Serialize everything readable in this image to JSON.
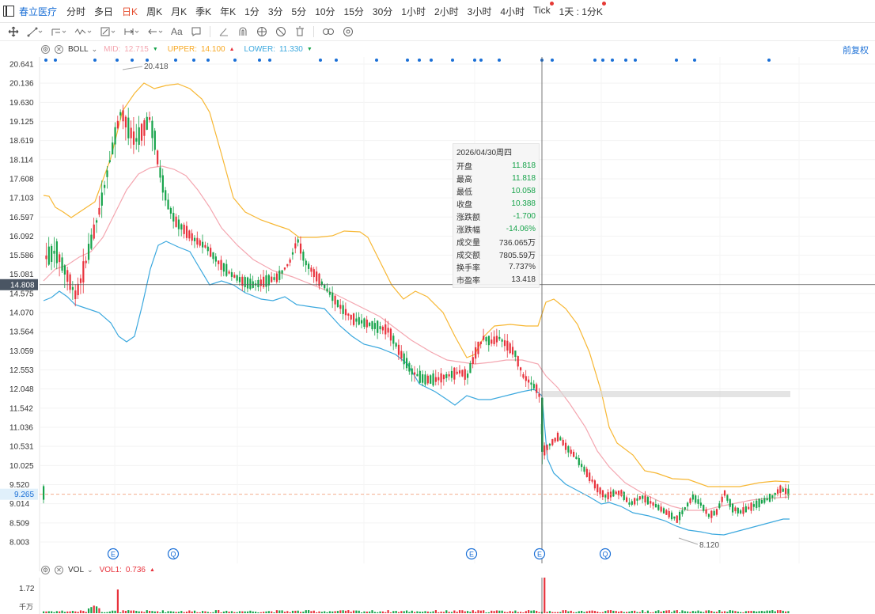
{
  "topbar": {
    "stock_name": "春立医疗",
    "periods": [
      "分时",
      "多日",
      "日K",
      "周K",
      "月K",
      "季K",
      "年K",
      "1分",
      "3分",
      "5分",
      "10分",
      "15分",
      "30分",
      "1小时",
      "2小时",
      "3小时",
      "4小时",
      "Tick",
      "1天 : 1分K"
    ],
    "active_period": "日K"
  },
  "toolbar": {
    "icons": [
      "crosshair-icon",
      "line-tool-icon",
      "channel-tool-icon",
      "wave-tool-icon",
      "measure-tool-icon",
      "range-tool-icon",
      "arrow-back-icon",
      "text-tool-icon",
      "comment-icon",
      "angle-icon",
      "magnet-icon",
      "eye-icon",
      "hide-icon",
      "trash-icon",
      "link-icon",
      "settings-icon"
    ],
    "text_tool_label": "Aa"
  },
  "boll": {
    "name": "BOLL",
    "mid_label": "MID:",
    "mid_value": "12.715",
    "upper_label": "UPPER:",
    "upper_value": "14.100",
    "lower_label": "LOWER:",
    "lower_value": "11.330",
    "colors": {
      "mid": "#f4a6b0",
      "upper": "#f7b733",
      "lower": "#3ba8de"
    }
  },
  "restore_label": "前复权",
  "tooltip": {
    "date": "2026/04/30周四",
    "rows": [
      {
        "k": "开盘",
        "v": "11.818",
        "color": "green"
      },
      {
        "k": "最高",
        "v": "11.818",
        "color": "green"
      },
      {
        "k": "最低",
        "v": "10.058",
        "color": "green"
      },
      {
        "k": "收盘",
        "v": "10.388",
        "color": "green"
      },
      {
        "k": "涨跌额",
        "v": "-1.700",
        "color": "green"
      },
      {
        "k": "涨跌幅",
        "v": "-14.06%",
        "color": "green"
      },
      {
        "k": "成交量",
        "v": "736.065万",
        "color": "gray"
      },
      {
        "k": "成交额",
        "v": "7805.59万",
        "color": "gray"
      },
      {
        "k": "换手率",
        "v": "7.737%",
        "color": "gray"
      },
      {
        "k": "市盈率",
        "v": "13.418",
        "color": "gray"
      }
    ]
  },
  "volume": {
    "name": "VOL",
    "vol1_label": "VOL1:",
    "vol1_value": "0.736",
    "axis_max": "1.72",
    "unit": "千万"
  },
  "chart_data": {
    "type": "candlestick",
    "y_ticks": [
      "20.641",
      "20.136",
      "19.630",
      "19.125",
      "18.619",
      "18.114",
      "17.608",
      "17.103",
      "16.597",
      "16.092",
      "15.586",
      "15.081",
      "14.575",
      "14.070",
      "13.564",
      "13.059",
      "12.553",
      "12.048",
      "11.542",
      "11.036",
      "10.531",
      "10.025",
      "9.520",
      "9.014",
      "8.509",
      "8.003"
    ],
    "ylim": [
      7.7,
      20.85
    ],
    "crosshair_price": "14.808",
    "current_price": "9.265",
    "high_label": "20.418",
    "low_label": "8.120",
    "event_markers": [
      "E",
      "Q",
      "E",
      "E",
      "Q"
    ],
    "colors": {
      "up": "#e8323c",
      "down": "#16a34a"
    }
  }
}
